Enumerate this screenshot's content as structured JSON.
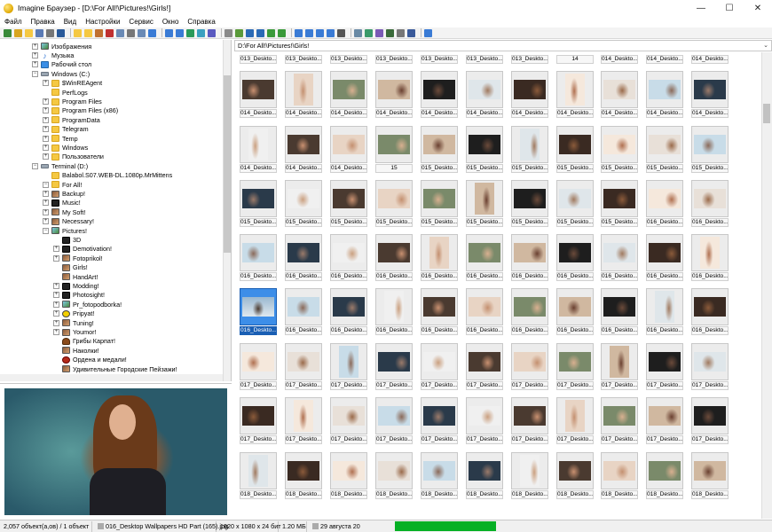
{
  "window": {
    "title": "Imagine Браузер - [D:\\For All!\\Pictures!\\Girls!]",
    "minimize": "—",
    "maximize": "☐",
    "close": "✕"
  },
  "menu": [
    "Файл",
    "Правка",
    "Вид",
    "Настройки",
    "Сервис",
    "Окно",
    "Справка"
  ],
  "toolbar_icons": [
    "refresh-icon",
    "folder-up-icon",
    "folder-icon",
    "copy-icon",
    "print-icon",
    "save-icon",
    "open-icon",
    "folder-new-icon",
    "move-icon",
    "delete-icon",
    "copy-file-icon",
    "cut-icon",
    "paste-icon",
    "view-icon",
    "details-icon",
    "thumbnails-icon",
    "history-icon",
    "map-icon",
    "slideshow-icon",
    "compare-icon",
    "image-icon",
    "back-icon",
    "forward-icon",
    "rotate-icon",
    "convert-icon",
    "list-icon",
    "grid-icon",
    "grid-small-icon",
    "grid-large-icon",
    "film-icon",
    "tools-icon",
    "batch-icon",
    "rename-icon",
    "capture-icon",
    "settings-icon",
    "edit-icon",
    "help-icon"
  ],
  "tree": [
    {
      "label": "Изображения",
      "indent": 1,
      "icon": "img",
      "exp": "+"
    },
    {
      "label": "Музыка",
      "indent": 1,
      "icon": "music",
      "exp": "+"
    },
    {
      "label": "Рабочий стол",
      "indent": 1,
      "icon": "desktop",
      "exp": "+"
    },
    {
      "label": "Windows (C:)",
      "indent": 1,
      "icon": "drive",
      "exp": "−"
    },
    {
      "label": "$WinREAgent",
      "indent": 2,
      "icon": "folder",
      "exp": "+"
    },
    {
      "label": "PerfLogs",
      "indent": 2,
      "icon": "folder",
      "exp": ""
    },
    {
      "label": "Program Files",
      "indent": 2,
      "icon": "folder",
      "exp": "+"
    },
    {
      "label": "Program Files (x86)",
      "indent": 2,
      "icon": "folder",
      "exp": "+"
    },
    {
      "label": "ProgramData",
      "indent": 2,
      "icon": "folder",
      "exp": "+"
    },
    {
      "label": "Telegram",
      "indent": 2,
      "icon": "folder",
      "exp": "+"
    },
    {
      "label": "Temp",
      "indent": 2,
      "icon": "folder",
      "exp": "+"
    },
    {
      "label": "Windows",
      "indent": 2,
      "icon": "folder",
      "exp": "+"
    },
    {
      "label": "Пользователи",
      "indent": 2,
      "icon": "folder",
      "exp": "+"
    },
    {
      "label": "Terminal (D:)",
      "indent": 1,
      "icon": "drive",
      "exp": "−"
    },
    {
      "label": "Balabol.S07.WEB-DL.1080p.MrMittens",
      "indent": 2,
      "icon": "folder",
      "exp": ""
    },
    {
      "label": "For All!",
      "indent": 2,
      "icon": "folder",
      "exp": "−"
    },
    {
      "label": "Backup!",
      "indent": 3,
      "icon": "thumb",
      "exp": "+"
    },
    {
      "label": "Music!",
      "indent": 3,
      "icon": "dark",
      "exp": "+"
    },
    {
      "label": "My Soft!",
      "indent": 3,
      "icon": "thumb",
      "exp": "+"
    },
    {
      "label": "Necessary!",
      "indent": 3,
      "icon": "thumb",
      "exp": "+"
    },
    {
      "label": "Pictures!",
      "indent": 3,
      "icon": "img",
      "exp": "−"
    },
    {
      "label": "3D",
      "indent": 4,
      "icon": "dark",
      "exp": ""
    },
    {
      "label": "Demotivation!",
      "indent": 4,
      "icon": "dark",
      "exp": "+"
    },
    {
      "label": "Fotoprikol!",
      "indent": 4,
      "icon": "thumb",
      "exp": "+"
    },
    {
      "label": "Girls!",
      "indent": 4,
      "icon": "thumb",
      "exp": ""
    },
    {
      "label": "HandArt!",
      "indent": 4,
      "icon": "thumb",
      "exp": ""
    },
    {
      "label": "Modding!",
      "indent": 4,
      "icon": "dark",
      "exp": "+"
    },
    {
      "label": "Photosight!",
      "indent": 4,
      "icon": "dark",
      "exp": "+"
    },
    {
      "label": "Pr_fotopodborka!",
      "indent": 4,
      "icon": "img",
      "exp": "+"
    },
    {
      "label": "Pripyat!",
      "indent": 4,
      "icon": "nuke",
      "exp": "+"
    },
    {
      "label": "Tuning!",
      "indent": 4,
      "icon": "thumb",
      "exp": "+"
    },
    {
      "label": "Youmor!",
      "indent": 4,
      "icon": "thumb",
      "exp": "+"
    },
    {
      "label": "Грибы Карпат!",
      "indent": 4,
      "icon": "mush",
      "exp": ""
    },
    {
      "label": "Наколки!",
      "indent": 4,
      "icon": "thumb",
      "exp": ""
    },
    {
      "label": "Ордена и медали!",
      "indent": 4,
      "icon": "red",
      "exp": ""
    },
    {
      "label": "Удивительные Городские Пейзажи!",
      "indent": 4,
      "icon": "thumb",
      "exp": ""
    },
    {
      "label": "Video!",
      "indent": 3,
      "icon": "thumb",
      "exp": "+"
    }
  ],
  "address": "D:\\For All!\\Pictures!\\Girls!",
  "grid_rows": [
    [
      "013_Deskto...",
      "013_Deskto...",
      "013_Deskto...",
      "013_Deskto...",
      "013_Deskto...",
      "013_Deskto...",
      "013_Deskto...",
      "14",
      "014_Deskto...",
      "014_Deskto...",
      "014_Deskto..."
    ],
    [
      "014_Deskto...",
      "014_Deskto...",
      "014_Deskto...",
      "014_Deskto...",
      "014_Deskto...",
      "014_Deskto...",
      "014_Deskto...",
      "014_Deskto...",
      "014_Deskto...",
      "014_Deskto...",
      "014_Deskto..."
    ],
    [
      "014_Deskto...",
      "014_Deskto...",
      "014_Deskto...",
      "15",
      "015_Deskto...",
      "015_Deskto...",
      "015_Deskto...",
      "015_Deskto...",
      "015_Deskto...",
      "015_Deskto...",
      "015_Deskto..."
    ],
    [
      "015_Deskto...",
      "015_Deskto...",
      "015_Deskto...",
      "015_Deskto...",
      "015_Deskto...",
      "015_Deskto...",
      "015_Deskto...",
      "015_Deskto...",
      "015_Deskto...",
      "016_Deskto...",
      "016_Deskto..."
    ],
    [
      "016_Deskto...",
      "016_Deskto...",
      "016_Deskto...",
      "016_Deskto...",
      "016_Deskto...",
      "016_Deskto...",
      "016_Deskto...",
      "016_Deskto...",
      "016_Deskto...",
      "016_Deskto...",
      "016_Deskto..."
    ],
    [
      "016_Deskto...",
      "016_Deskto...",
      "016_Deskto...",
      "016_Deskto...",
      "016_Deskto...",
      "016_Deskto...",
      "016_Deskto...",
      "016_Deskto...",
      "016_Deskto...",
      "016_Deskto...",
      "016_Deskto..."
    ],
    [
      "017_Deskto...",
      "017_Deskto...",
      "017_Deskto...",
      "017_Deskto...",
      "017_Deskto...",
      "017_Deskto...",
      "017_Deskto...",
      "017_Deskto...",
      "017_Deskto...",
      "017_Deskto...",
      "017_Deskto..."
    ],
    [
      "017_Deskto...",
      "017_Deskto...",
      "017_Deskto...",
      "017_Deskto...",
      "017_Deskto...",
      "017_Deskto...",
      "017_Deskto...",
      "017_Deskto...",
      "017_Deskto...",
      "017_Deskto...",
      "017_Deskto..."
    ],
    [
      "018_Deskto...",
      "018_Deskto...",
      "018_Deskto...",
      "018_Deskto...",
      "018_Deskto...",
      "018_Deskto...",
      "018_Deskto...",
      "018_Deskto...",
      "018_Deskto...",
      "018_Deskto...",
      "018_Deskto..."
    ]
  ],
  "selected_caption": "016_Deskto...",
  "status": {
    "objects": "2,057 объект(а,ов) / 1 объект",
    "filename": "016_Desktop Wallpapers  HD Part (165).jpg",
    "dimensions": "1920 x 1080 x 24 бит",
    "filesize": "1.20 МБ",
    "date": "29 августа 20"
  },
  "colors": {
    "selection": "#1a5fb4",
    "progress": "#06b025",
    "folder": "#f5c842"
  }
}
